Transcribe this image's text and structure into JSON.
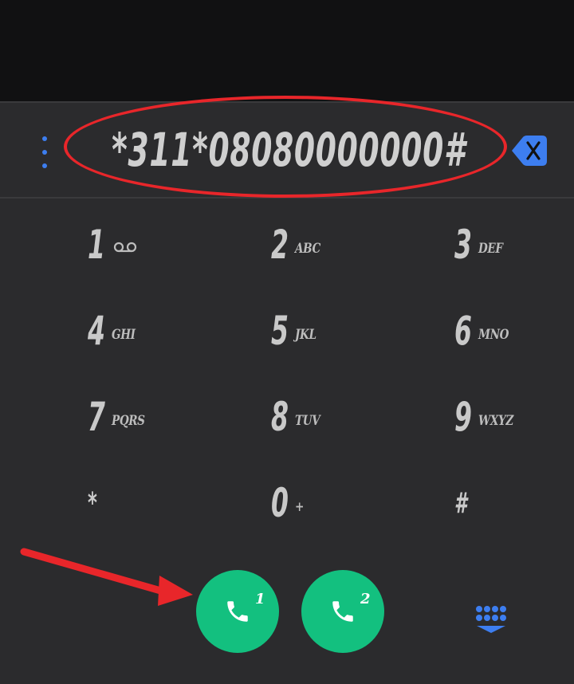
{
  "dialer": {
    "number": "*311*08080000000#",
    "keys": [
      {
        "digit": "1",
        "letters": "",
        "icon": "voicemail-icon"
      },
      {
        "digit": "2",
        "letters": "ABC"
      },
      {
        "digit": "3",
        "letters": "DEF"
      },
      {
        "digit": "4",
        "letters": "GHI"
      },
      {
        "digit": "5",
        "letters": "JKL"
      },
      {
        "digit": "6",
        "letters": "MNO"
      },
      {
        "digit": "7",
        "letters": "PQRS"
      },
      {
        "digit": "8",
        "letters": "TUV"
      },
      {
        "digit": "9",
        "letters": "WXYZ"
      },
      {
        "digit": "*",
        "letters": ""
      },
      {
        "digit": "0",
        "letters": "+"
      },
      {
        "digit": "#",
        "letters": ""
      }
    ],
    "call_buttons": [
      {
        "sim": "1"
      },
      {
        "sim": "2"
      }
    ]
  },
  "colors": {
    "background": "#2b2b2d",
    "top_area": "#111112",
    "accent_blue": "#3d7ef0",
    "call_green": "#13c07f",
    "annotation_red": "#e8262a",
    "key_text": "#c9c9c9"
  },
  "icons": {
    "menu": "more-vert-icon",
    "backspace": "backspace-icon",
    "call": "phone-icon",
    "dialpad_toggle": "dialpad-icon"
  }
}
